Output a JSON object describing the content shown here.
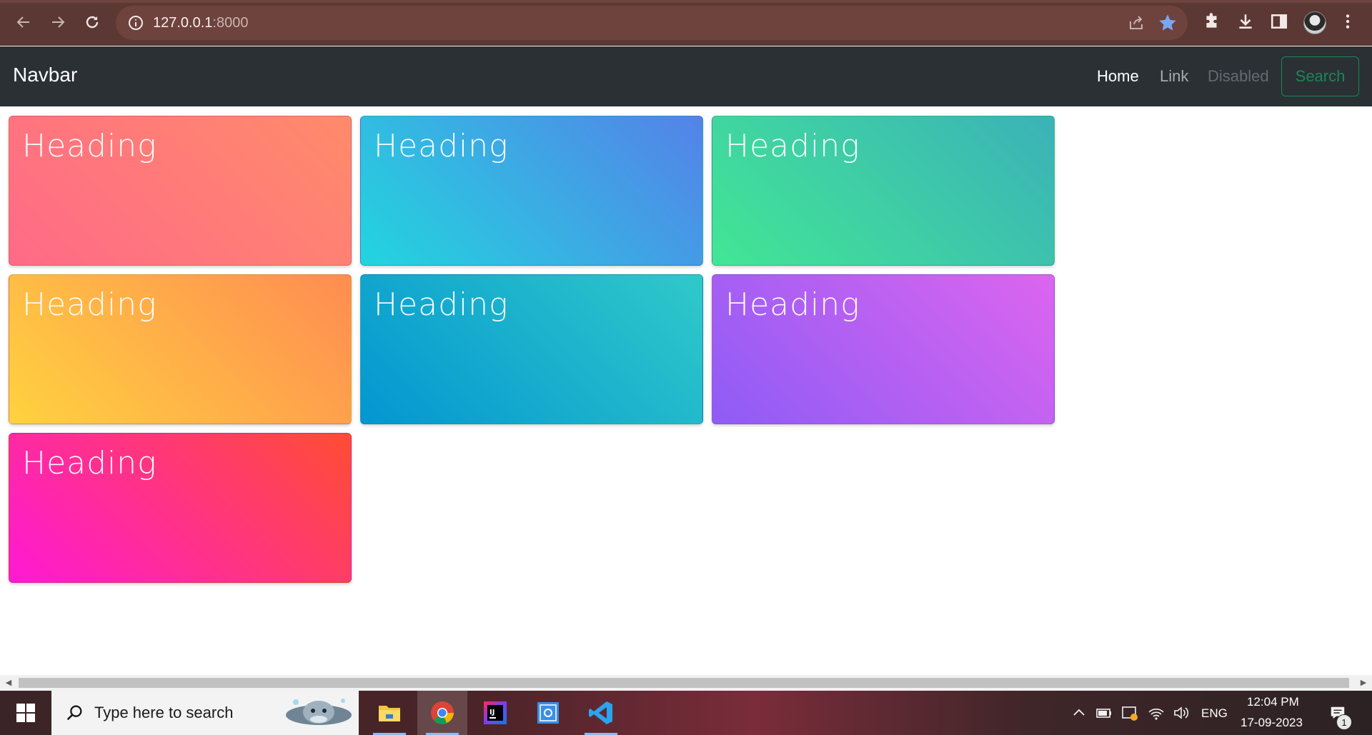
{
  "browser": {
    "url_host": "127.0.0.1",
    "url_port": ":8000"
  },
  "navbar": {
    "brand": "Navbar",
    "links": [
      "Home",
      "Link",
      "Disabled"
    ],
    "search_button": "Search"
  },
  "cards": [
    {
      "title": "Heading"
    },
    {
      "title": "Heading"
    },
    {
      "title": "Heading"
    },
    {
      "title": "Heading"
    },
    {
      "title": "Heading"
    },
    {
      "title": "Heading"
    },
    {
      "title": "Heading"
    }
  ],
  "taskbar": {
    "search_placeholder": "Type here to search",
    "language": "ENG",
    "time": "12:04 PM",
    "date": "17-09-2023",
    "notification_count": "1"
  },
  "colors": {
    "navbar_bg": "#2b3035",
    "search_outline": "#198754",
    "chrome_frame": "#5b3833"
  }
}
